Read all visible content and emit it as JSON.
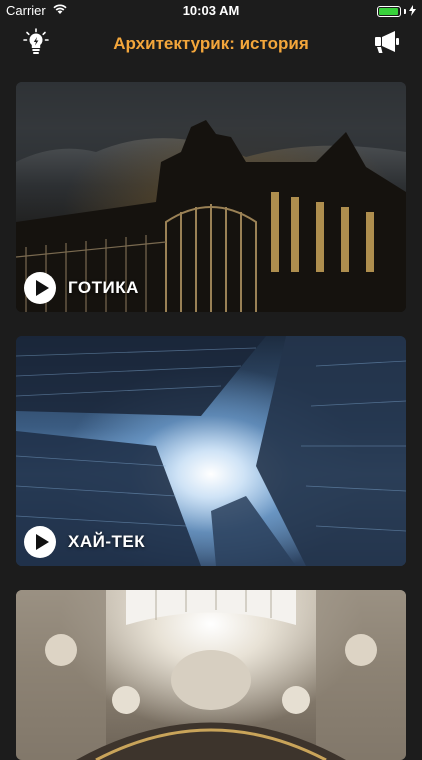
{
  "status_bar": {
    "carrier": "Carrier",
    "time": "10:03 AM",
    "battery_level": 0.95,
    "battery_color": "#38d13b"
  },
  "nav": {
    "title": "Архитектурик: история",
    "left_icon": "lightbulb-icon",
    "right_icon": "megaphone-icon",
    "title_color": "#f3a63b"
  },
  "cards": [
    {
      "title": "ГОТИКА",
      "play_icon": "play-icon"
    },
    {
      "title": "ХАЙ-ТЕК",
      "play_icon": "play-icon"
    },
    {
      "title": "",
      "play_icon": ""
    }
  ]
}
